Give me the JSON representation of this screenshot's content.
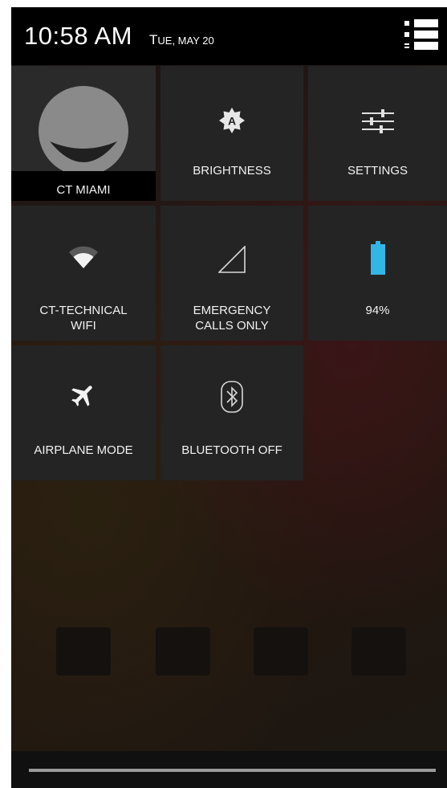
{
  "status_bar": {
    "time": "10:58 AM",
    "date_first": "T",
    "date_rest": "UE, MAY 20"
  },
  "tiles": {
    "user": {
      "label": "CT MIAMI",
      "icon": "user-avatar-icon"
    },
    "brightness": {
      "label": "BRIGHTNESS",
      "icon": "brightness-auto-icon"
    },
    "settings": {
      "label": "SETTINGS",
      "icon": "settings-sliders-icon"
    },
    "wifi": {
      "label_line1": "CT-TECHNICAL",
      "label_line2": "WIFI",
      "icon": "wifi-icon"
    },
    "signal": {
      "label_line1": "EMERGENCY",
      "label_line2": "CALLS ONLY",
      "icon": "signal-icon"
    },
    "battery": {
      "label": "94%",
      "icon": "battery-icon",
      "level_percent": 94,
      "color": "#33b5e5"
    },
    "airplane": {
      "label": "AIRPLANE MODE",
      "icon": "airplane-icon"
    },
    "bluetooth": {
      "label": "BLUETOOTH OFF",
      "icon": "bluetooth-icon"
    }
  },
  "colors": {
    "tile_background": "#242424",
    "status_bar_background": "#000000",
    "accent": "#33b5e5"
  }
}
